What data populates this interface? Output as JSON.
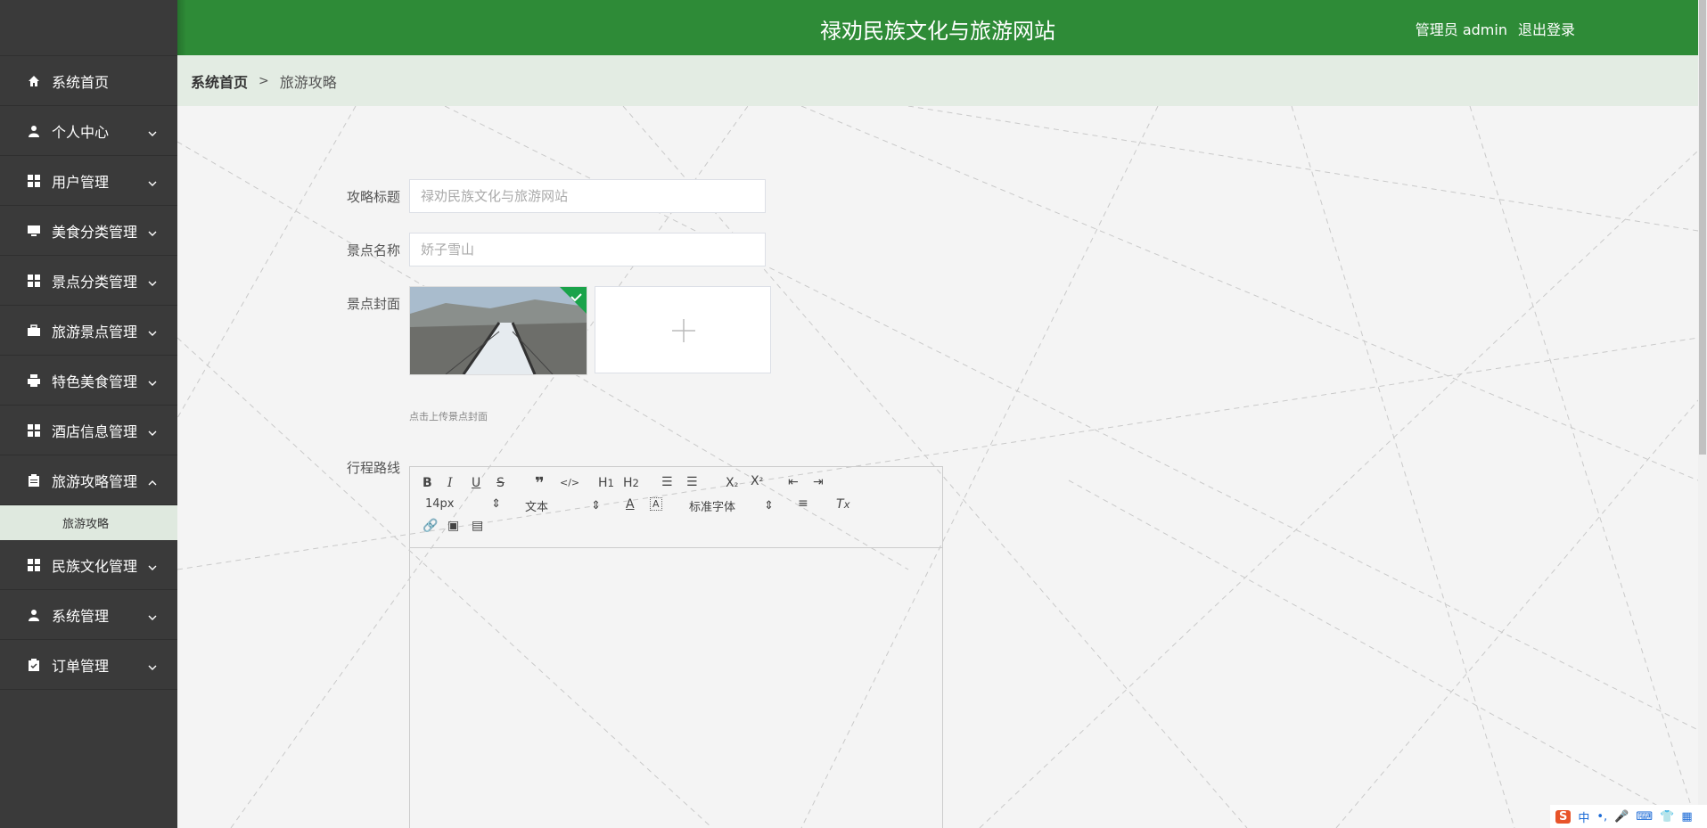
{
  "header": {
    "title": "禄劝民族文化与旅游网站",
    "user_label": "管理员 admin",
    "logout": "退出登录"
  },
  "breadcrumb": {
    "home": "系统首页",
    "sep": ">",
    "current": "旅游攻略"
  },
  "sidebar": {
    "items": [
      {
        "label": "系统首页",
        "icon": "home-icon"
      },
      {
        "label": "个人中心",
        "icon": "user-icon"
      },
      {
        "label": "用户管理",
        "icon": "grid-icon"
      },
      {
        "label": "美食分类管理",
        "icon": "monitor-icon"
      },
      {
        "label": "景点分类管理",
        "icon": "grid-icon"
      },
      {
        "label": "旅游景点管理",
        "icon": "briefcase-icon"
      },
      {
        "label": "特色美食管理",
        "icon": "printer-icon"
      },
      {
        "label": "酒店信息管理",
        "icon": "grid-icon"
      },
      {
        "label": "旅游攻略管理",
        "icon": "clipboard-icon"
      },
      {
        "label": "民族文化管理",
        "icon": "grid-icon"
      },
      {
        "label": "系统管理",
        "icon": "user-icon"
      },
      {
        "label": "订单管理",
        "icon": "checklist-icon"
      }
    ],
    "submenu": {
      "label": "旅游攻略"
    }
  },
  "form": {
    "title_label": "攻略标题",
    "title_value": "禄劝民族文化与旅游网站",
    "scenic_label": "景点名称",
    "scenic_value": "娇子雪山",
    "cover_label": "景点封面",
    "upload_tip": "点击上传景点封面",
    "route_label": "行程路线"
  },
  "editor": {
    "font_size": "14px",
    "header_select": "文本",
    "font_select": "标准字体"
  },
  "ime": {
    "lang": "中"
  }
}
